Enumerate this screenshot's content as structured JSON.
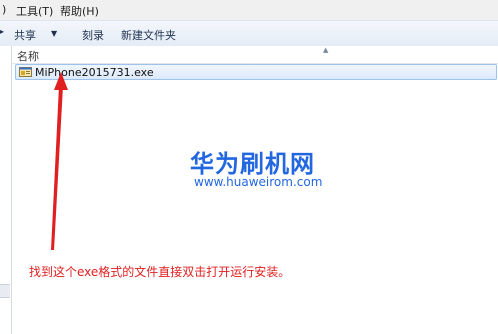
{
  "menubar": {
    "left_cut_label": ")",
    "tools_label": "工具(T)",
    "help_label": "帮助(H)"
  },
  "toolbar": {
    "share_label": "共享",
    "burn_label": "刻录",
    "new_folder_label": "新建文件夹"
  },
  "file_list": {
    "column_name_header": "名称",
    "files": [
      {
        "name": "MiPhone2015731.exe",
        "icon": "exe-app-icon"
      }
    ]
  },
  "watermark": {
    "title": "华为刷机网",
    "url": "www.huaweirom.com"
  },
  "annotation": {
    "caption": "找到这个exe格式的文件直接双击打开运行安装。"
  },
  "colors": {
    "accent_blue": "#2266e0",
    "annotation_red": "#e02020",
    "selection_border": "#9ec2ee"
  }
}
